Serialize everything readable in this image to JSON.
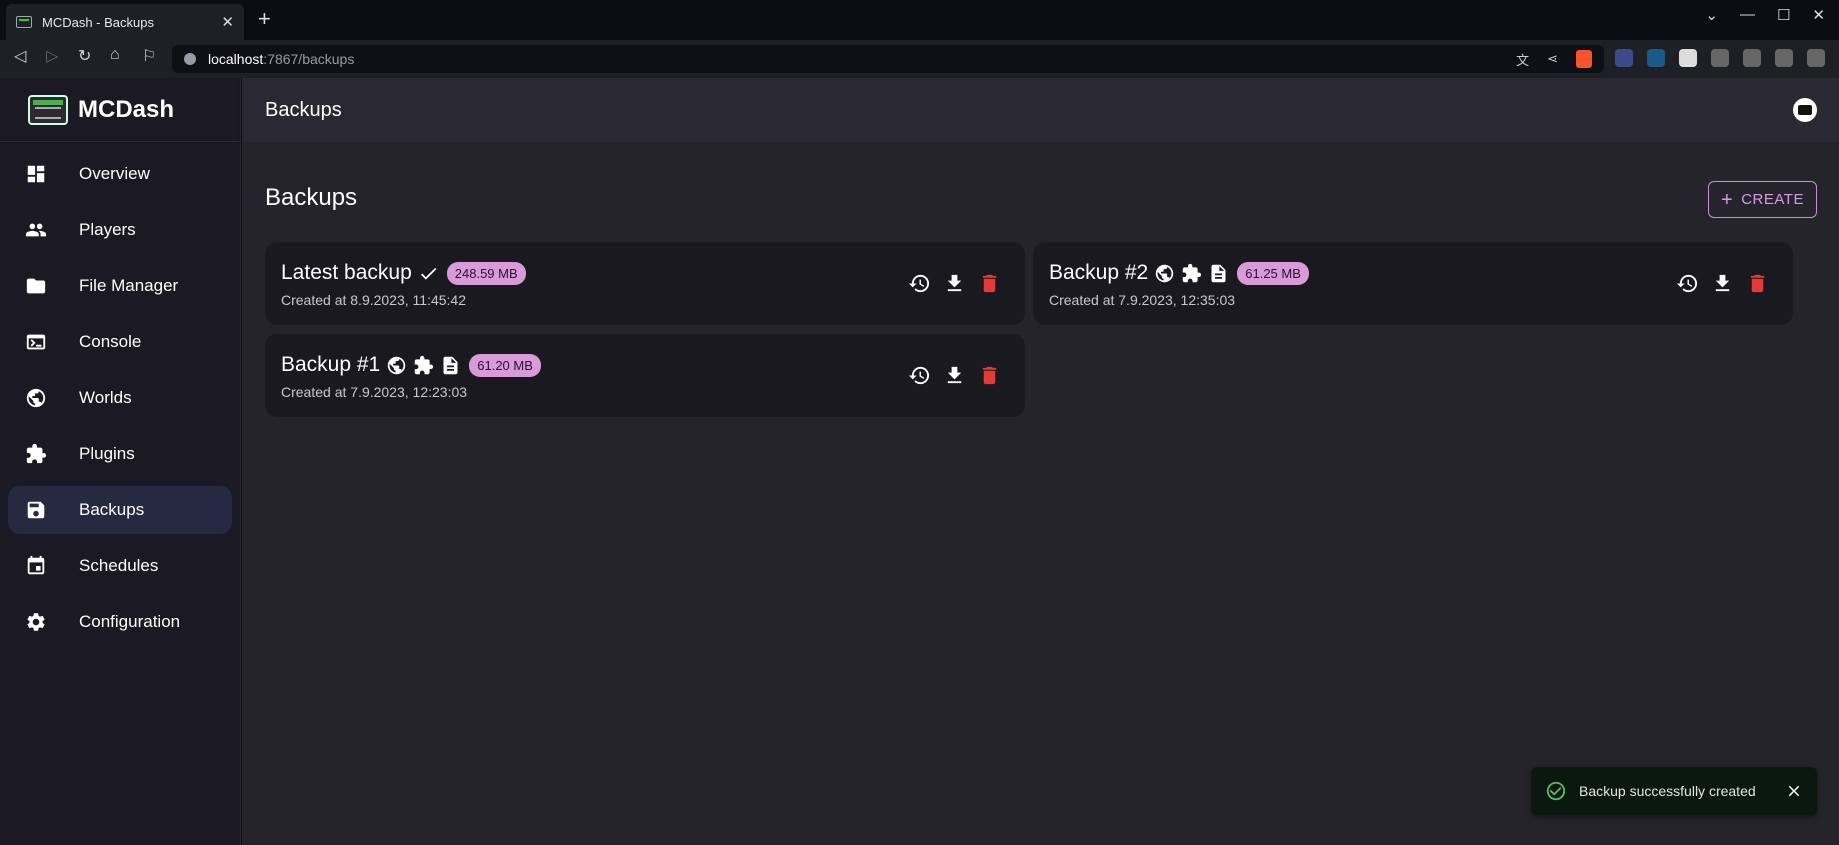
{
  "browser": {
    "tab_title": "MCDash - Backups",
    "url_host": "localhost",
    "url_path": ":7867/backups"
  },
  "app": {
    "brand": "MCDash",
    "topbar_title": "Backups"
  },
  "sidebar": {
    "items": [
      {
        "label": "Overview",
        "icon": "dashboard-icon"
      },
      {
        "label": "Players",
        "icon": "people-icon"
      },
      {
        "label": "File Manager",
        "icon": "folder-icon"
      },
      {
        "label": "Console",
        "icon": "terminal-icon"
      },
      {
        "label": "Worlds",
        "icon": "globe-icon"
      },
      {
        "label": "Plugins",
        "icon": "puzzle-icon"
      },
      {
        "label": "Backups",
        "icon": "save-icon",
        "active": true
      },
      {
        "label": "Schedules",
        "icon": "calendar-icon"
      },
      {
        "label": "Configuration",
        "icon": "gear-icon"
      }
    ]
  },
  "main": {
    "title": "Backups",
    "create_label": "CREATE",
    "backups": [
      {
        "name": "Latest backup",
        "size": "248.59 MB",
        "created": "Created at 8.9.2023, 11:45:42",
        "icons": [
          "check-icon"
        ]
      },
      {
        "name": "Backup #2",
        "size": "61.25 MB",
        "created": "Created at 7.9.2023, 12:35:03",
        "icons": [
          "globe-icon",
          "puzzle-icon",
          "file-icon"
        ]
      },
      {
        "name": "Backup #1",
        "size": "61.20 MB",
        "created": "Created at 7.9.2023, 12:23:03",
        "icons": [
          "globe-icon",
          "puzzle-icon",
          "file-icon"
        ]
      }
    ]
  },
  "toast": {
    "message": "Backup successfully created"
  },
  "colors": {
    "accent": "#d99ad9",
    "danger": "#e53935",
    "success": "#5dba63"
  }
}
